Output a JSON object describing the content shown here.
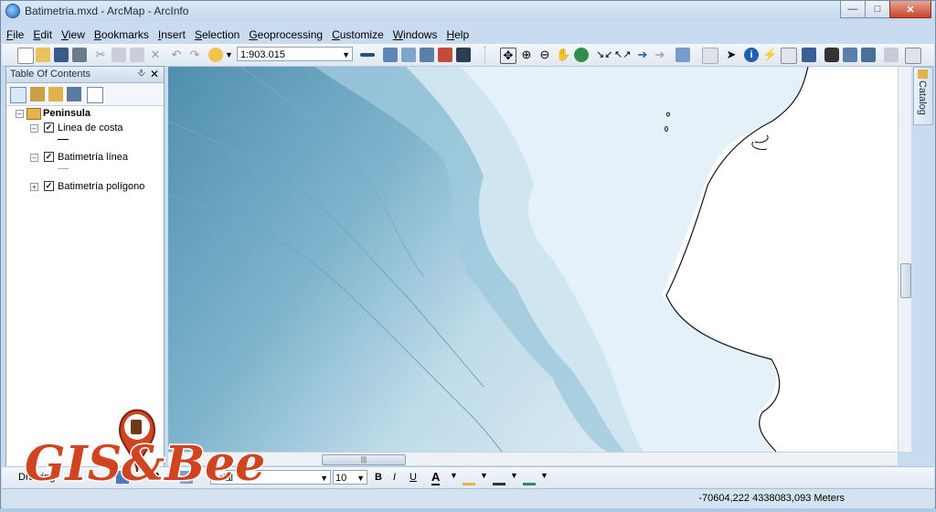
{
  "window": {
    "title": "Batimetria.mxd - ArcMap - ArcInfo"
  },
  "menu": [
    {
      "label": "File",
      "u": "F",
      "rest": "ile"
    },
    {
      "label": "Edit",
      "u": "E",
      "rest": "dit"
    },
    {
      "label": "View",
      "u": "V",
      "rest": "iew"
    },
    {
      "label": "Bookmarks",
      "u": "B",
      "rest": "ookmarks"
    },
    {
      "label": "Insert",
      "u": "I",
      "rest": "nsert"
    },
    {
      "label": "Selection",
      "u": "S",
      "rest": "election"
    },
    {
      "label": "Geoprocessing",
      "u": "G",
      "rest": "eoprocessing"
    },
    {
      "label": "Customize",
      "u": "C",
      "rest": "ustomize"
    },
    {
      "label": "Windows",
      "u": "W",
      "rest": "indows"
    },
    {
      "label": "Help",
      "u": "H",
      "rest": "elp"
    }
  ],
  "toolbar": {
    "scale_value": "1:903.015"
  },
  "toc": {
    "title": "Table Of Contents",
    "pin_icon": "pin-icon",
    "close_icon": "close-icon",
    "group": "Peninsula",
    "layers": [
      {
        "name": "Linea de costa",
        "checked": true,
        "expanded": true
      },
      {
        "name": "Batimetría línea",
        "checked": true,
        "expanded": true
      },
      {
        "name": "Batimetría polígono",
        "checked": true,
        "expanded": false
      }
    ]
  },
  "catalog": {
    "label": "Catalog"
  },
  "drawing": {
    "label": "Drawing",
    "font": "Arial",
    "size": "10",
    "bold": "B",
    "italic": "I",
    "underline": "U",
    "font_color": "A"
  },
  "status": {
    "coordinates": "-70604,222  4338083,093 Meters"
  },
  "watermark": {
    "text": "GIS&Beers"
  },
  "colors": {
    "deep": "#5c9ab8",
    "shallow": "#e4f1f8",
    "land": "#ffffff",
    "coast": "#111111"
  }
}
